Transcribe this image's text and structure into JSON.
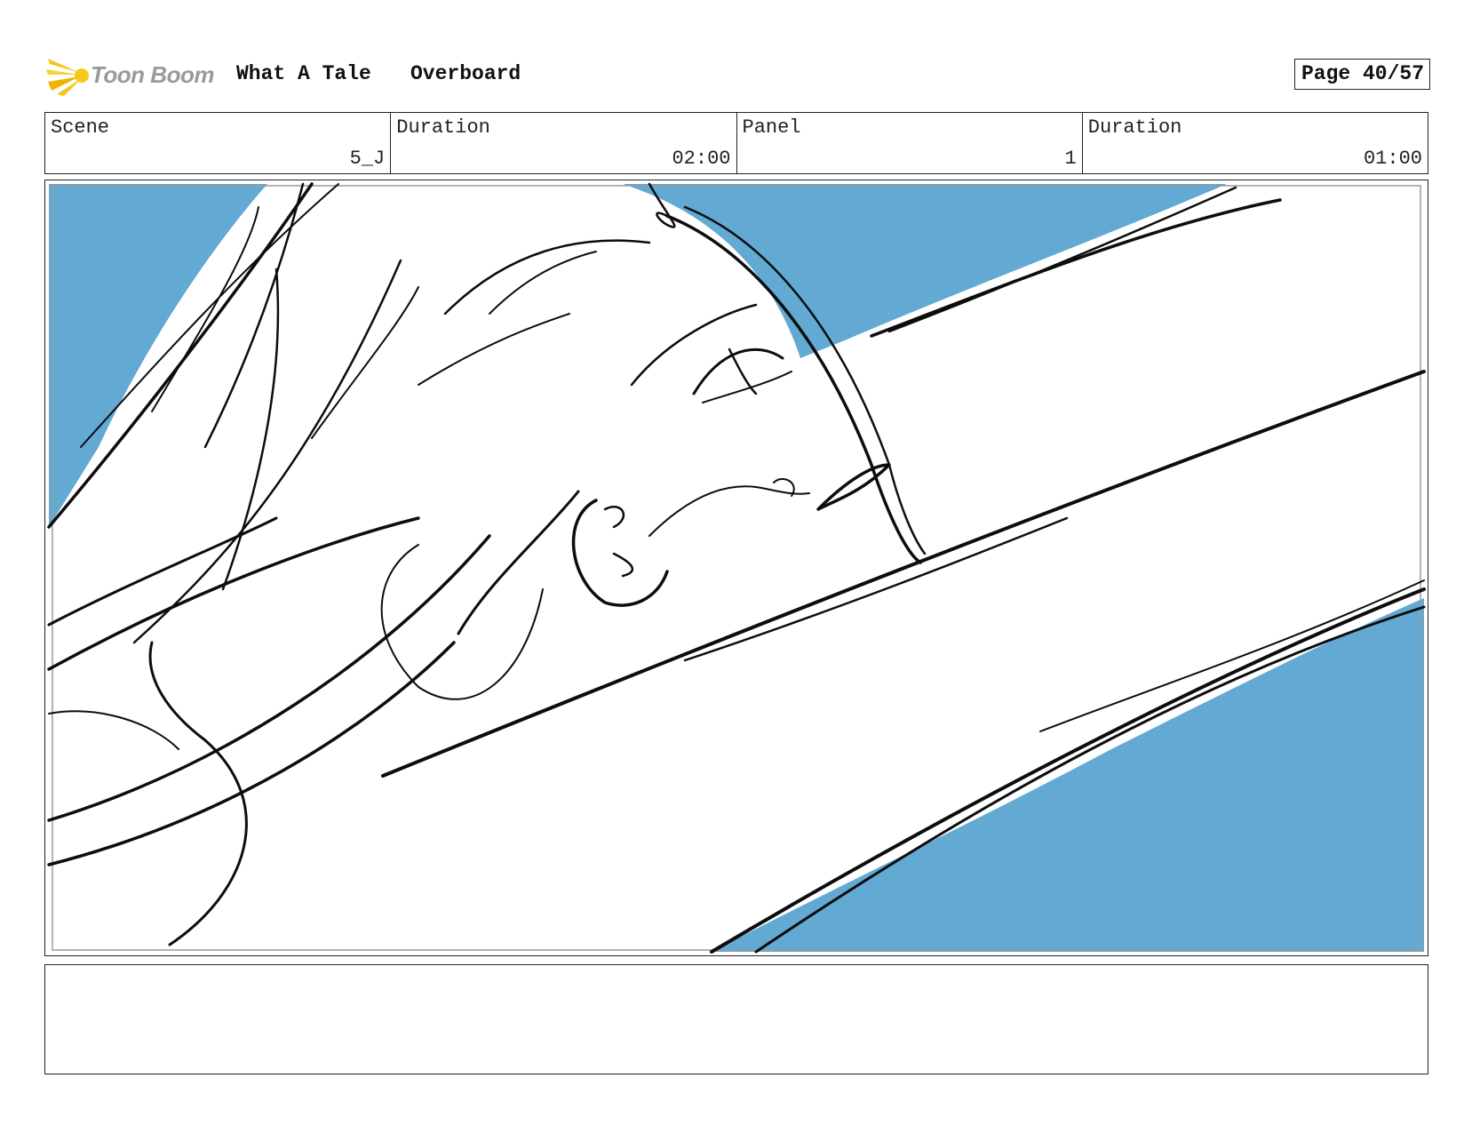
{
  "header": {
    "logo_text": "Toon Boom",
    "project_title": "What A Tale",
    "episode_title": "Overboard",
    "page_label": "Page 40/57"
  },
  "info": {
    "scene_label": "Scene",
    "scene_value": "5_J",
    "scene_duration_label": "Duration",
    "scene_duration_value": "02:00",
    "panel_label": "Panel",
    "panel_value": "1",
    "panel_duration_label": "Duration",
    "panel_duration_value": "01:00"
  },
  "colors": {
    "sky_blue": "#62aad3",
    "ink": "#0d0d0d",
    "logo_yellow": "#f5c518",
    "logo_gray": "#9a9a9a"
  },
  "notes": {
    "text": ""
  }
}
